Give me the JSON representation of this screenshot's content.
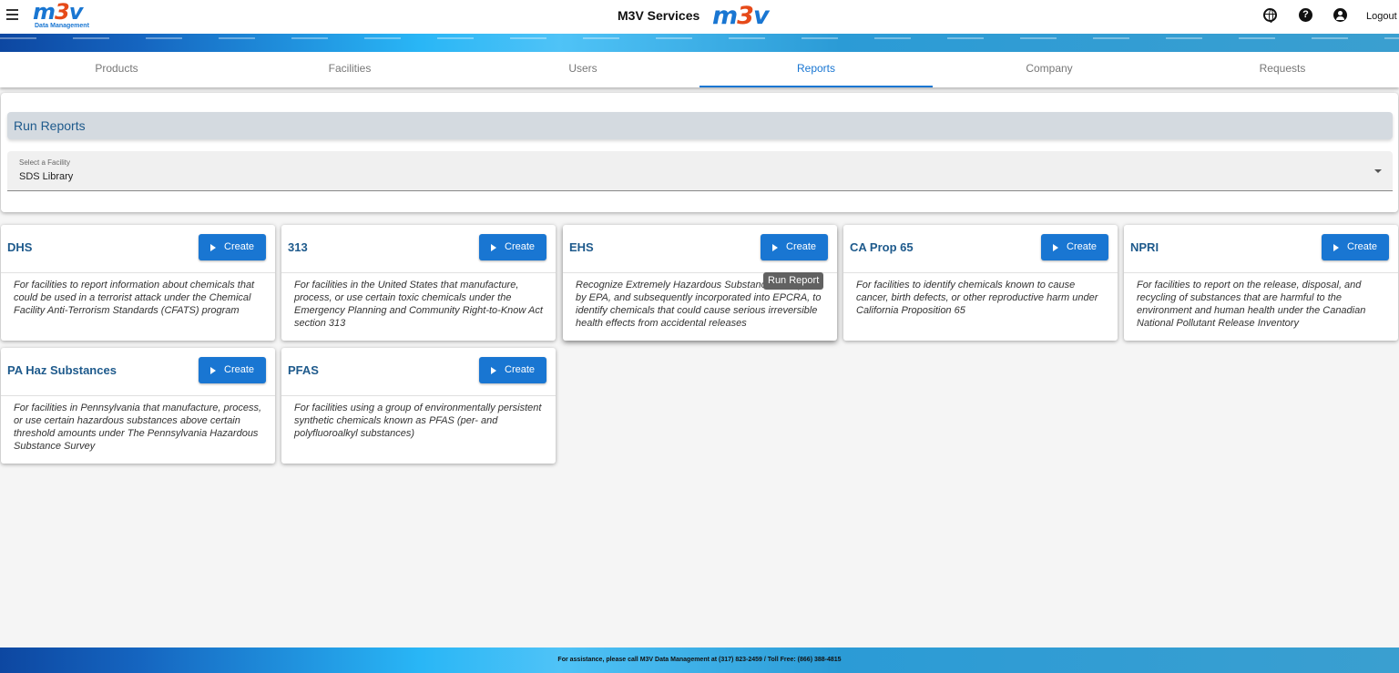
{
  "header": {
    "logo_text": "m3v",
    "logo_subtitle": "Data Management",
    "title": "M3V Services",
    "center_logo_text": "m3v",
    "help_glyph": "?",
    "logout_label": "Logout",
    "icons": [
      "menu-icon",
      "globe-icon",
      "help-icon",
      "account-icon"
    ]
  },
  "tabs": [
    {
      "label": "Products",
      "active": false
    },
    {
      "label": "Facilities",
      "active": false
    },
    {
      "label": "Users",
      "active": false
    },
    {
      "label": "Reports",
      "active": true
    },
    {
      "label": "Company",
      "active": false
    },
    {
      "label": "Requests",
      "active": false
    }
  ],
  "run_reports": {
    "title": "Run Reports",
    "facility_select": {
      "label": "Select a Facility",
      "value": "SDS Library"
    }
  },
  "reports": [
    {
      "title": "DHS",
      "button": "Create",
      "description": "For facilities to report information about chemicals that could be used in a terrorist attack under the Chemical Facility Anti-Terrorism Standards (CFATS) program"
    },
    {
      "title": "313",
      "button": "Create",
      "description": "For facilities in the United States that manufacture, process, or use certain toxic chemicals under the Emergency Planning and Community Right-to-Know Act section 313"
    },
    {
      "title": "EHS",
      "button": "Create",
      "description": "Recognize Extremely Hazardous Substances compiled by EPA, and subsequently incorporated into EPCRA, to identify chemicals that could cause serious irreversible health effects from accidental releases"
    },
    {
      "title": "CA Prop 65",
      "button": "Create",
      "description": "For facilities to identify chemicals known to cause cancer, birth defects, or other reproductive harm under California Proposition 65"
    },
    {
      "title": "NPRI",
      "button": "Create",
      "description": "For facilities to report on the release, disposal, and recycling of substances that are harmful to the environment and human health under the Canadian National Pollutant Release Inventory"
    },
    {
      "title": "PA Haz Substances",
      "button": "Create",
      "description": "For facilities in Pennsylvania that manufacture, process, or use certain hazardous substances above certain threshold amounts under The Pennsylvania Hazardous Substance Survey"
    },
    {
      "title": "PFAS",
      "button": "Create",
      "description": "For facilities using a group of environmentally persistent synthetic chemicals known as PFAS (per- and polyfluoroalkyl substances)"
    }
  ],
  "tooltip": "Run Report",
  "footer": {
    "text": "For assistance, please call M3V Data Management at (317) 823-2459 / Toll Free: (866) 388-4815"
  },
  "colors": {
    "accent": "#1976d2",
    "title_blue": "#1e5a8c",
    "logo_three": "#e64a19"
  }
}
